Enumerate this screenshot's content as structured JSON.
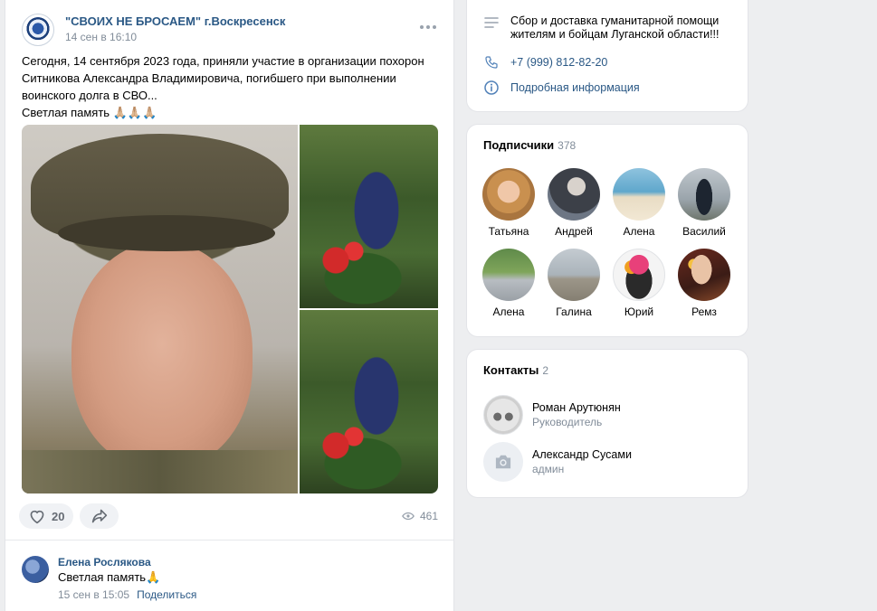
{
  "post": {
    "group_name": "\"СВОИХ НЕ БРОСАЕМ\"",
    "group_city": "г.Воскресенск",
    "time": "14 сен в 16:10",
    "text_line1": "Сегодня, 14 сентября 2023 года, приняли участие в организации похорон Ситникова Александра Владимировича, погибшего при выполнении воинского долга в СВО...",
    "text_line2": "Светлая память 🙏🏼🙏🏼🙏🏼",
    "likes": "20",
    "views": "461",
    "icons": {
      "like": "heart-icon",
      "share": "share-icon",
      "views": "eye-icon",
      "more": "more-icon"
    }
  },
  "comment": {
    "author": "Елена Рослякова",
    "text": "Светлая память🙏",
    "time": "15 сен в 15:05",
    "reply": "Поделиться"
  },
  "info": {
    "description": "Сбор и доставка гуманитарной помощи жителям и бойцам Луганской области!!!",
    "phone": "+7 (999) 812-82-20",
    "more": "Подробная информация"
  },
  "subscribers": {
    "title": "Подписчики",
    "count": "378",
    "items": [
      {
        "name": "Татьяна"
      },
      {
        "name": "Андрей"
      },
      {
        "name": "Алена"
      },
      {
        "name": "Василий"
      },
      {
        "name": "Алена"
      },
      {
        "name": "Галина"
      },
      {
        "name": "Юрий"
      },
      {
        "name": "Ремз"
      }
    ]
  },
  "contacts": {
    "title": "Контакты",
    "count": "2",
    "items": [
      {
        "name": "Роман Арутюнян",
        "role": "Руководитель"
      },
      {
        "name": "Александр Сусами",
        "role": "админ"
      }
    ]
  },
  "colors": {
    "link": "#2a5885",
    "muted": "#818c99",
    "background": "#edeef0"
  }
}
